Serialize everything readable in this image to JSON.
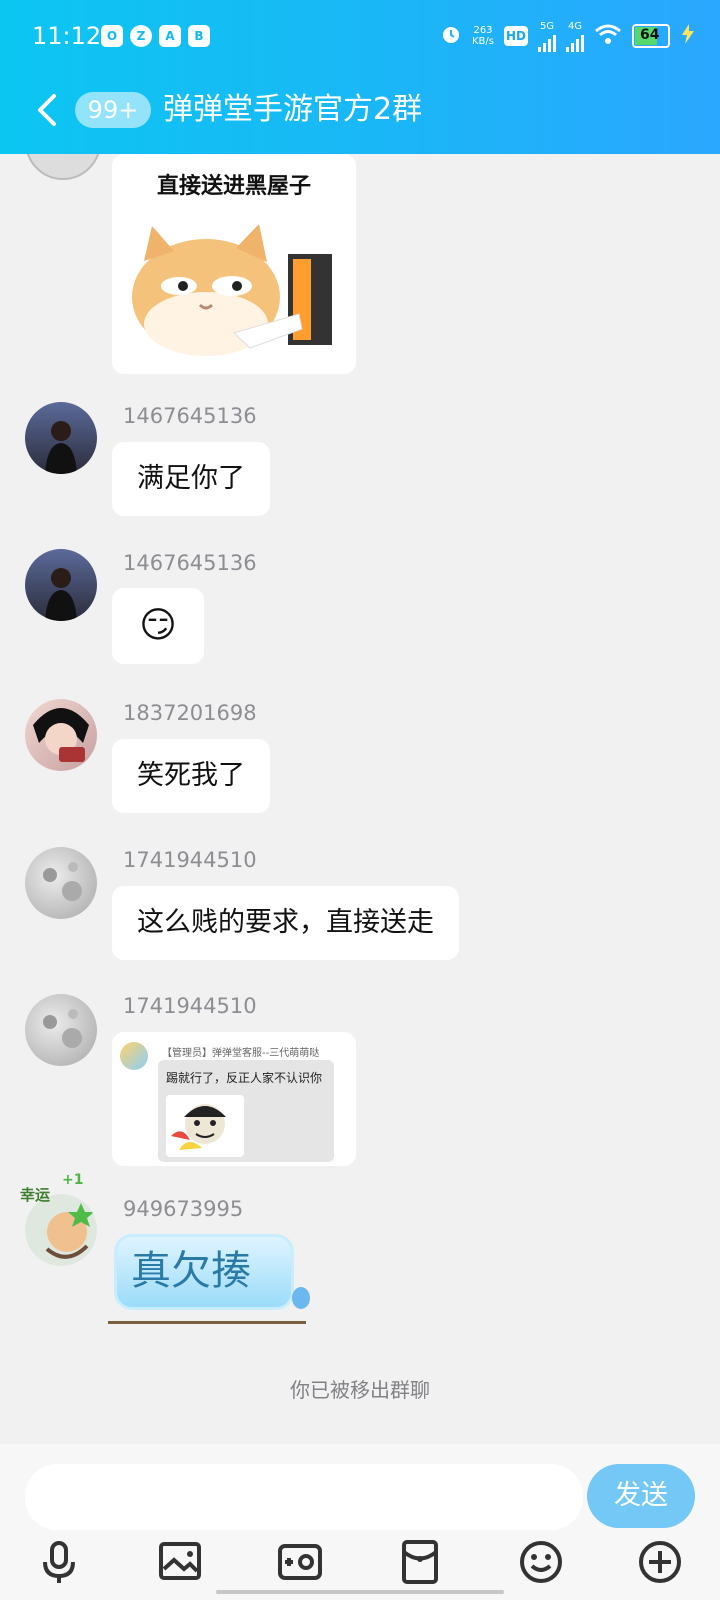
{
  "status": {
    "time": "11:12",
    "speed_value": "263",
    "speed_unit": "KB/s",
    "hd": "HD",
    "net_5g": "5G",
    "net_4g": "4G",
    "battery": "64",
    "apps": [
      "O",
      "Z",
      "A",
      "B"
    ]
  },
  "header": {
    "badge": "99+",
    "title": "弹弹堂手游官方2群"
  },
  "messages": [
    {
      "type": "sticker",
      "caption": "直接送进黑屋子"
    },
    {
      "sender": "1467645136",
      "type": "text",
      "text": "满足你了"
    },
    {
      "sender": "1467645136",
      "type": "emoji",
      "emoji": "😏"
    },
    {
      "sender": "1837201698",
      "type": "text",
      "text": "笑死我了"
    },
    {
      "sender": "1741944510",
      "type": "text",
      "text": "这么贱的要求，直接送走"
    },
    {
      "sender": "1741944510",
      "type": "quoted",
      "quote_title": "【管理员】弹弹堂客服--三代萌萌哒",
      "quote_text": "踢就行了，反正人家不认识你"
    },
    {
      "sender": "949673995",
      "type": "text_sticker",
      "avatar_label": "幸运",
      "avatar_badge": "+1",
      "text": "真欠揍"
    }
  ],
  "system_note": "你已被移出群聊",
  "input": {
    "placeholder": "",
    "send_label": "发送"
  },
  "toolbar_icons": [
    "microphone-icon",
    "image-icon",
    "camera-icon",
    "red-packet-icon",
    "emoji-icon",
    "plus-icon"
  ]
}
